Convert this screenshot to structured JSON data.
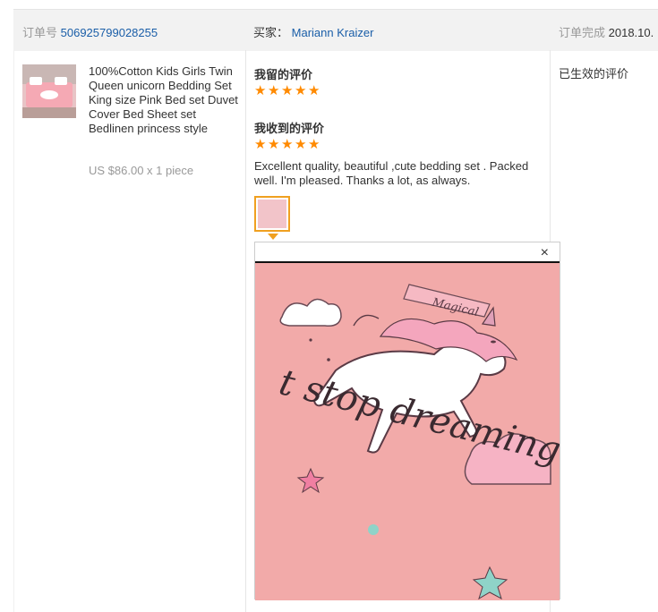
{
  "header": {
    "order_label": "订单号",
    "order_number": "506925799028255",
    "buyer_label": "买家：",
    "buyer_name": "Mariann Kraizer",
    "completed_label": "订单完成",
    "completed_date": "2018.10."
  },
  "product": {
    "title": "100%Cotton Kids Girls Twin Queen unicorn Bedding Set King size Pink Bed set Duvet Cover Bed Sheet set Bedlinen princess style",
    "price": "US $86.00 x 1 piece"
  },
  "my_review": {
    "heading": "我留的评价",
    "rating": 5
  },
  "received_review": {
    "heading": "我收到的评价",
    "rating": 5,
    "text": "Excellent quality, beautiful ,cute bedding set . Packed well. I'm pleased. Thanks a lot, as always."
  },
  "status": {
    "text": "已生效的评价"
  },
  "popup": {
    "close_glyph": "×",
    "image_text_banner": "Magical",
    "image_text_main": "t stop dreaming"
  },
  "colors": {
    "star": "#ff8a00",
    "link": "#1a5ea8",
    "thumb_border": "#f0a020",
    "photo_background": "#f2aaa9"
  },
  "icons": {
    "star": "star-icon",
    "close": "close-icon"
  }
}
